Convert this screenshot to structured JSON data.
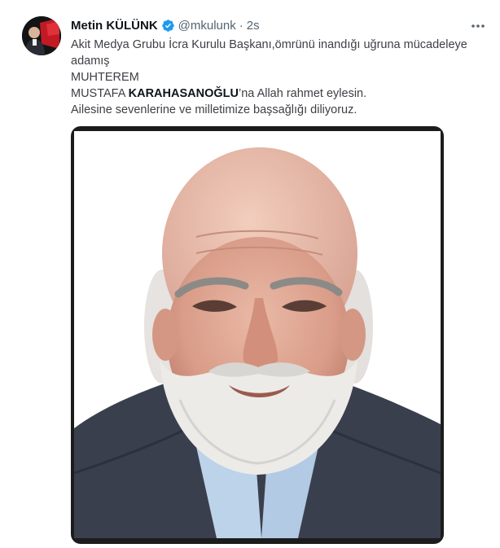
{
  "user": {
    "display_name": "Metin KÜLÜNK",
    "handle": "@mkulunk",
    "separator": "·",
    "timestamp": "2s"
  },
  "icons": {
    "verified": "verified-badge-icon",
    "more": "more-options-icon"
  },
  "colors": {
    "verified": "#1d9bf0",
    "secondary_text": "#536471",
    "media_frame": "#1c1c1c"
  },
  "tweet": {
    "line1": "Akit Medya Grubu İcra Kurulu Başkanı,ömrünü inandığı uğruna mücadeleye adamış",
    "line2": "MUHTEREM",
    "line3_prefix": "MUSTAFA ",
    "line3_bold": "KARAHASANOĞLU",
    "line3_suffix": "’na Allah rahmet eylesin.",
    "line4": "Ailesine sevenlerine ve milletimize başsağlığı diliyoruz."
  }
}
